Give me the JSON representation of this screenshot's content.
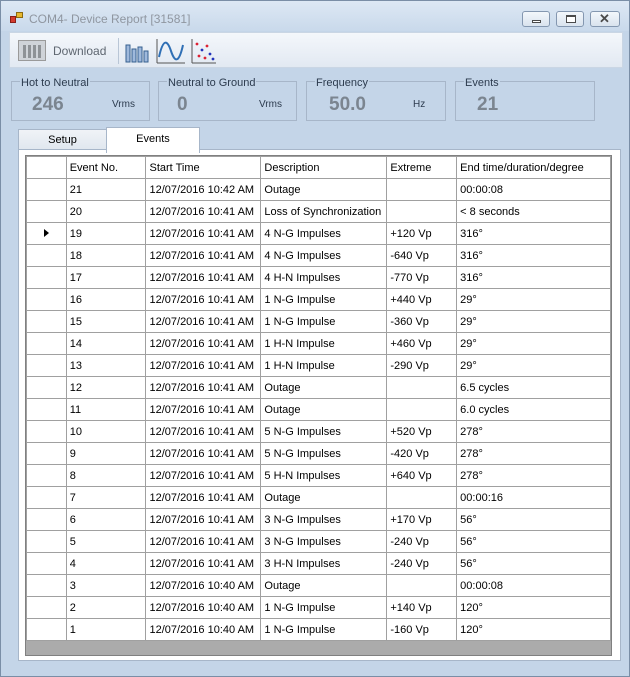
{
  "window": {
    "title": "COM4- Device Report [31581]"
  },
  "toolbar": {
    "download_label": "Download",
    "icons": [
      "download-icon",
      "bar-graph-icon",
      "waveform-icon",
      "scatter-plot-icon"
    ]
  },
  "gauges": [
    {
      "title": "Hot to Neutral",
      "value": "246",
      "unit": "Vrms"
    },
    {
      "title": "Neutral to Ground",
      "value": "0",
      "unit": "Vrms"
    },
    {
      "title": "Frequency",
      "value": "50.0",
      "unit": "Hz"
    },
    {
      "title": "Events",
      "value": "21",
      "unit": ""
    }
  ],
  "tabs": [
    {
      "label": "Setup"
    },
    {
      "label": "Events",
      "selected": true
    }
  ],
  "grid": {
    "columns": [
      "Event No.",
      "Start Time",
      "Description",
      "Extreme",
      "End time/duration/degree"
    ],
    "current_row_event": "19",
    "rows": [
      [
        "21",
        "12/07/2016 10:42 AM",
        "Outage",
        "",
        "00:00:08"
      ],
      [
        "20",
        "12/07/2016 10:41 AM",
        "Loss of Synchronization",
        "",
        "< 8  seconds"
      ],
      [
        "19",
        "12/07/2016 10:41 AM",
        "4 N-G Impulses",
        "+120 Vp",
        "316°"
      ],
      [
        "18",
        "12/07/2016 10:41 AM",
        "4 N-G Impulses",
        "-640 Vp",
        "316°"
      ],
      [
        "17",
        "12/07/2016 10:41 AM",
        "4 H-N Impulses",
        "-770 Vp",
        "316°"
      ],
      [
        "16",
        "12/07/2016 10:41 AM",
        "1 N-G Impulse",
        "+440 Vp",
        "29°"
      ],
      [
        "15",
        "12/07/2016 10:41 AM",
        "1 N-G Impulse",
        "-360 Vp",
        "29°"
      ],
      [
        "14",
        "12/07/2016 10:41 AM",
        "1 H-N Impulse",
        "+460 Vp",
        "29°"
      ],
      [
        "13",
        "12/07/2016 10:41 AM",
        "1 H-N Impulse",
        "-290 Vp",
        "29°"
      ],
      [
        "12",
        "12/07/2016 10:41 AM",
        "Outage",
        "",
        "6.5 cycles"
      ],
      [
        "11",
        "12/07/2016 10:41 AM",
        "Outage",
        "",
        "6.0 cycles"
      ],
      [
        "10",
        "12/07/2016 10:41 AM",
        "5 N-G Impulses",
        "+520 Vp",
        "278°"
      ],
      [
        "9",
        "12/07/2016 10:41 AM",
        "5 N-G Impulses",
        "-420 Vp",
        "278°"
      ],
      [
        "8",
        "12/07/2016 10:41 AM",
        "5 H-N Impulses",
        "+640 Vp",
        "278°"
      ],
      [
        "7",
        "12/07/2016 10:41 AM",
        "Outage",
        "",
        "00:00:16"
      ],
      [
        "6",
        "12/07/2016 10:41 AM",
        "3 N-G Impulses",
        "+170 Vp",
        "56°"
      ],
      [
        "5",
        "12/07/2016 10:41 AM",
        "3 N-G Impulses",
        "-240 Vp",
        "56°"
      ],
      [
        "4",
        "12/07/2016 10:41 AM",
        "3 H-N Impulses",
        "-240 Vp",
        "56°"
      ],
      [
        "3",
        "12/07/2016 10:40 AM",
        "Outage",
        "",
        "00:00:08"
      ],
      [
        "2",
        "12/07/2016 10:40 AM",
        "1 N-G Impulse",
        "+140 Vp",
        "120°"
      ],
      [
        "1",
        "12/07/2016 10:40 AM",
        "1 N-G Impulse",
        "-160 Vp",
        "120°"
      ]
    ]
  }
}
